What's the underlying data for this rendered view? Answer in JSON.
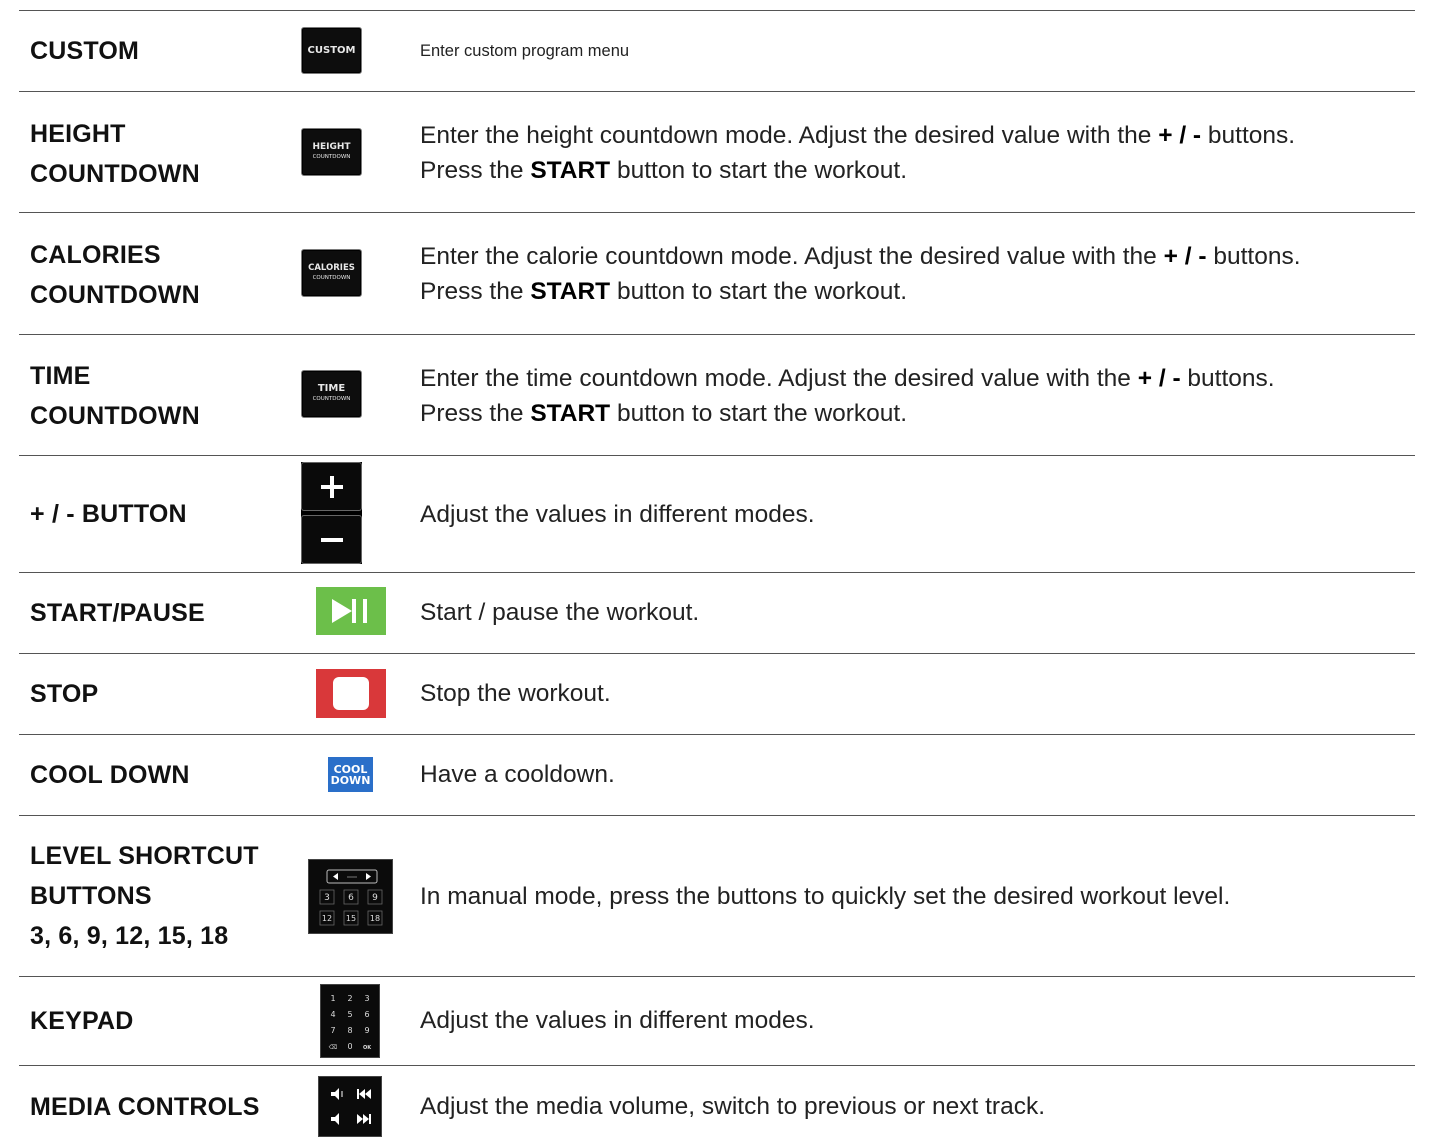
{
  "rows": [
    {
      "label_lines": [
        "CUSTOM"
      ],
      "icon": "custom-button-icon",
      "icon_text": "CUSTOM",
      "desc_line1": "Enter custom program menu"
    },
    {
      "label_lines": [
        "HEIGHT",
        "COUNTDOWN"
      ],
      "icon": "height-countdown-button-icon",
      "icon_text1": "HEIGHT",
      "icon_text2": "COUNTDOWN",
      "desc_pre": "Enter the height countdown mode. Adjust the desired value with the ",
      "desc_bold": "+ / -",
      "desc_post": " buttons.",
      "desc2_pre": "Press the ",
      "desc2_bold": "START",
      "desc2_post": " button to start the workout."
    },
    {
      "label_lines": [
        "CALORIES",
        "COUNTDOWN"
      ],
      "icon": "calories-countdown-button-icon",
      "icon_text1": "CALORIES",
      "icon_text2": "COUNTDOWN",
      "desc_pre": "Enter the calorie countdown mode. Adjust the desired value with the ",
      "desc_bold": "+ / -",
      "desc_post": " buttons.",
      "desc2_pre": "Press the ",
      "desc2_bold": "START",
      "desc2_post": " button to start the workout."
    },
    {
      "label_lines": [
        "TIME",
        "COUNTDOWN"
      ],
      "icon": "time-countdown-button-icon",
      "icon_text1": "TIME",
      "icon_text2": "COUNTDOWN",
      "desc_pre": "Enter the time countdown mode. Adjust the desired value with the ",
      "desc_bold": "+ / -",
      "desc_post": " buttons.",
      "desc2_pre": "Press the ",
      "desc2_bold": "START",
      "desc2_post": " button to start the workout."
    },
    {
      "label_lines": [
        "+ / - BUTTON"
      ],
      "icon": "plus-minus-buttons-icon",
      "desc_line1": "Adjust the values in different modes."
    },
    {
      "label_lines": [
        "START/PAUSE"
      ],
      "icon": "play-pause-icon",
      "icon_color": "#6cbf4a",
      "desc_line1": "Start / pause the workout."
    },
    {
      "label_lines": [
        "STOP"
      ],
      "icon": "stop-icon",
      "icon_color": "#d9383a",
      "desc_line1": "Stop the workout."
    },
    {
      "label_lines": [
        "COOL DOWN"
      ],
      "icon": "cool-down-button-icon",
      "icon_color": "#2a6fc9",
      "icon_text1": "COOL",
      "icon_text2": "DOWN",
      "desc_line1": "Have a cooldown."
    },
    {
      "label_lines": [
        "LEVEL SHORTCUT",
        "BUTTONS",
        "3, 6, 9, 12, 15, 18"
      ],
      "icon": "level-shortcut-panel-icon",
      "shortcut_values": [
        "3",
        "6",
        "9",
        "12",
        "15",
        "18"
      ],
      "desc_line1": "In manual mode, press the buttons to quickly set the desired workout level."
    },
    {
      "label_lines": [
        "KEYPAD"
      ],
      "icon": "keypad-icon",
      "keys": [
        "1",
        "2",
        "3",
        "4",
        "5",
        "6",
        "7",
        "8",
        "9",
        "⌫",
        "0",
        "OK"
      ],
      "desc_line1": "Adjust the values in different modes."
    },
    {
      "label_lines": [
        "MEDIA CONTROLS"
      ],
      "icon": "media-controls-icon",
      "media_glyphs": [
        "◂·",
        "⏮",
        "◂",
        "⏭"
      ],
      "desc_line1": "Adjust the media volume, switch to previous or next track."
    }
  ]
}
